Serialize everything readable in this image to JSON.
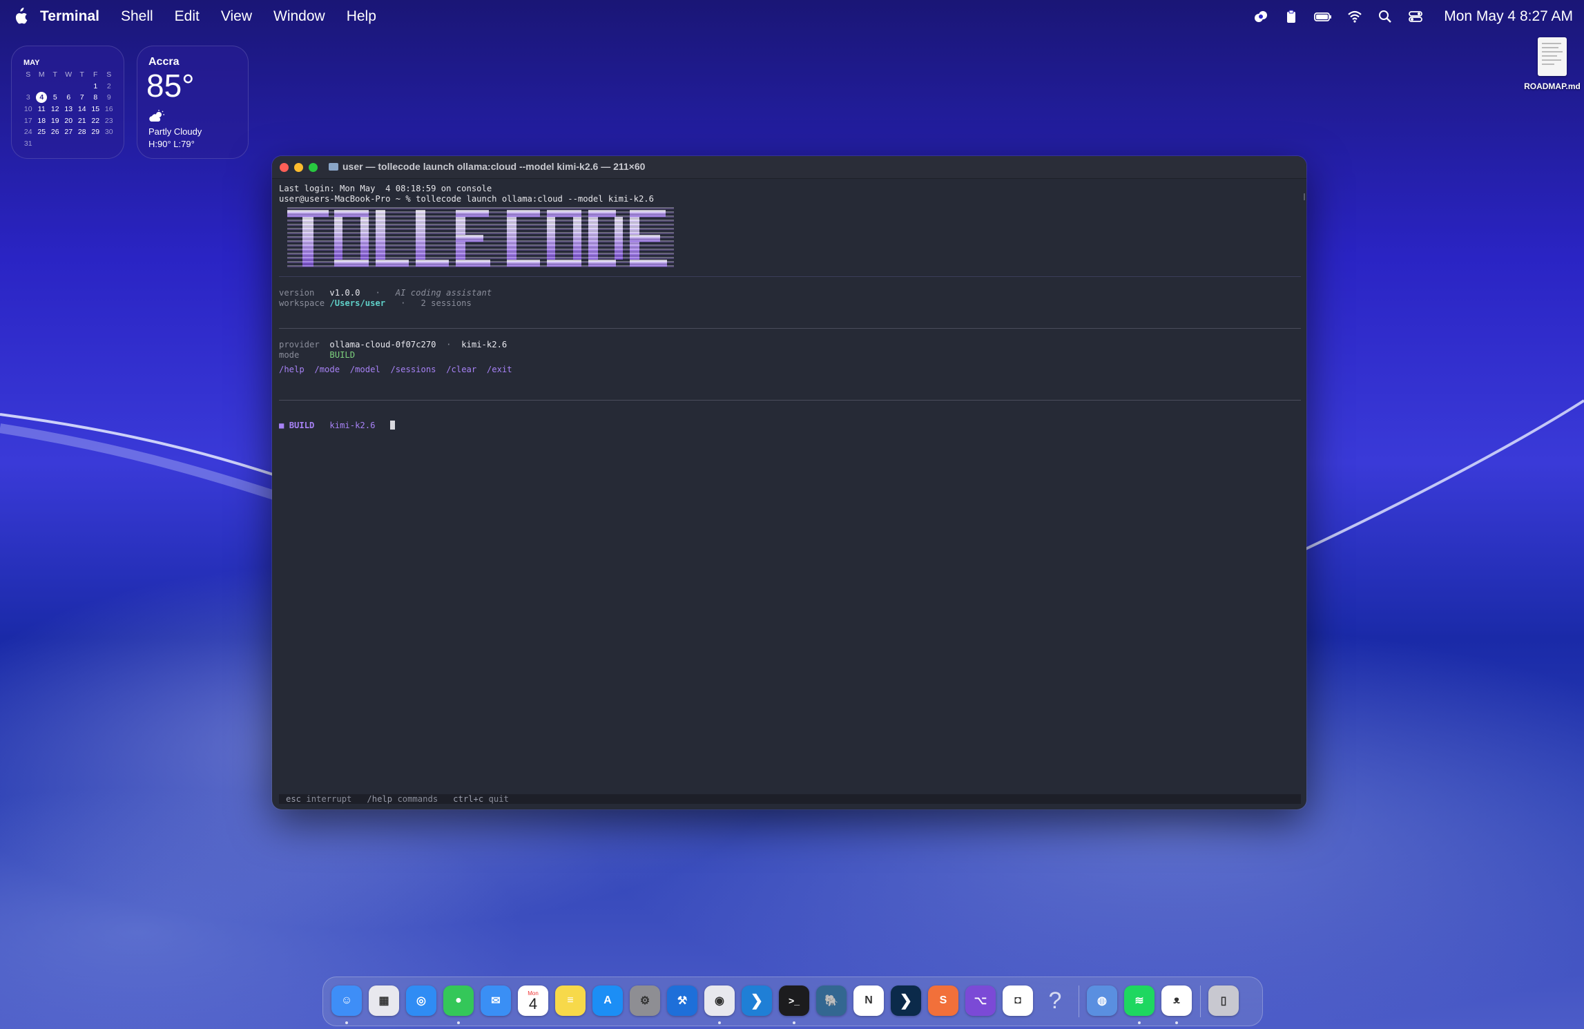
{
  "menubar": {
    "app": "Terminal",
    "menus": [
      "Shell",
      "Edit",
      "View",
      "Window",
      "Help"
    ],
    "clock": "Mon May 4  8:27 AM",
    "status_icons": [
      "creative-cloud-icon",
      "clipboard-icon",
      "battery-icon",
      "wifi-icon",
      "spotlight-search-icon",
      "control-center-icon"
    ]
  },
  "calendar": {
    "month": "MAY",
    "weekdays": [
      "S",
      "M",
      "T",
      "W",
      "T",
      "F",
      "S"
    ],
    "weeks": [
      [
        "",
        "",
        "",
        "",
        "",
        "1",
        "2"
      ],
      [
        "3",
        "4",
        "5",
        "6",
        "7",
        "8",
        "9"
      ],
      [
        "10",
        "11",
        "12",
        "13",
        "14",
        "15",
        "16"
      ],
      [
        "17",
        "18",
        "19",
        "20",
        "21",
        "22",
        "23"
      ],
      [
        "24",
        "25",
        "26",
        "27",
        "28",
        "29",
        "30"
      ],
      [
        "31",
        "",
        "",
        "",
        "",
        "",
        ""
      ]
    ],
    "today": "4"
  },
  "weather": {
    "city": "Accra",
    "temp": "85°",
    "condition": "Partly Cloudy",
    "hilo": "H:90° L:79°"
  },
  "desktop": {
    "file_name": "ROADMAP.md"
  },
  "terminal": {
    "title": "user — tollecode launch ollama:cloud --model kimi-k2.6 — 211×60",
    "last_login": "Last login: Mon May  4 08:18:59 on console",
    "prompt": "user@users-MacBook-Pro ~ % tollecode launch ollama:cloud --model kimi-k2.6",
    "banner_text": "TOLLE CODE",
    "info": {
      "version_label": "version",
      "version": "v1.0.0",
      "sep": "·",
      "tagline": "AI coding assistant",
      "workspace_label": "workspace",
      "workspace": "/Users/user",
      "sessions": "2 sessions"
    },
    "provider": {
      "provider_label": "provider",
      "provider": "ollama-cloud-0f07c270",
      "model": "kimi-k2.6",
      "mode_label": "mode",
      "mode": "BUILD"
    },
    "commands": [
      "/help",
      "/mode",
      "/model",
      "/sessions",
      "/clear",
      "/exit"
    ],
    "status": {
      "mode": "BUILD",
      "model": "kimi-k2.6"
    },
    "footer": [
      {
        "key": "esc",
        "desc": "interrupt"
      },
      {
        "key": "/help",
        "desc": "commands"
      },
      {
        "key": "ctrl+c",
        "desc": "quit"
      }
    ]
  },
  "dock": {
    "apps": [
      {
        "name": "finder",
        "color": "#3e8ef7",
        "running": true
      },
      {
        "name": "launchpad",
        "color": "#e8e8ee",
        "running": false
      },
      {
        "name": "safari",
        "color": "#2f8cf4",
        "running": false
      },
      {
        "name": "messages",
        "color": "#34c759",
        "running": true
      },
      {
        "name": "mail",
        "color": "#3a8ff5",
        "running": false
      },
      {
        "name": "calendar",
        "color": "#ffffff",
        "running": false
      },
      {
        "name": "notes",
        "color": "#f7d94a",
        "running": false
      },
      {
        "name": "app-store",
        "color": "#1c8ef5",
        "running": false
      },
      {
        "name": "system-settings",
        "color": "#8e8e93",
        "running": false
      },
      {
        "name": "xcode",
        "color": "#1e6fd9",
        "running": false
      },
      {
        "name": "chrome",
        "color": "#e8e8ee",
        "running": true
      },
      {
        "name": "vscode",
        "color": "#1f7fd6",
        "running": false
      },
      {
        "name": "terminal",
        "color": "#1c1c1e",
        "running": true
      },
      {
        "name": "postgres",
        "color": "#336791",
        "running": false
      },
      {
        "name": "notion",
        "color": "#ffffff",
        "running": false
      },
      {
        "name": "prompt",
        "color": "#0b2a4a",
        "running": false
      },
      {
        "name": "suno",
        "color": "#f2703a",
        "running": false
      },
      {
        "name": "github-desktop",
        "color": "#7b4ad6",
        "running": false
      },
      {
        "name": "game-controller",
        "color": "#ffffff",
        "running": false
      },
      {
        "name": "help",
        "color": "transparent",
        "running": false
      },
      {
        "name": "disk-utility",
        "color": "#5a8fe0",
        "running": false
      },
      {
        "name": "spotify",
        "color": "#1ed760",
        "running": true
      },
      {
        "name": "ollama",
        "color": "#ffffff",
        "running": true
      },
      {
        "name": "trash",
        "color": "#c8c8d0",
        "running": false
      }
    ],
    "calendar_day": "Mon",
    "calendar_date": "4"
  }
}
